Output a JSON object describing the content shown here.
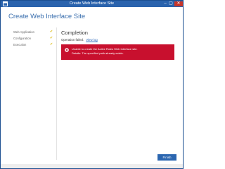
{
  "window": {
    "title": "Create Web Interface Site",
    "controls": {
      "minimize": "–",
      "maximize": "▢",
      "close": "✕"
    }
  },
  "page": {
    "heading": "Create Web Interface Site"
  },
  "nav": {
    "items": [
      {
        "label": "Web Application",
        "status": "done"
      },
      {
        "label": "Configuration",
        "status": "done"
      },
      {
        "label": "Execution",
        "status": "done"
      }
    ]
  },
  "main": {
    "section_title": "Completion",
    "status_text": "Operation failed.",
    "status_link": "View log",
    "error": {
      "line1": "Unable to create the Active Roles Web Interface site.",
      "line2": "Details: The specified path already exists."
    }
  },
  "footer": {
    "finish_label": "Finish"
  },
  "colors": {
    "titlebar": "#2a63ad",
    "heading": "#3a6fae",
    "error_bg": "#c8102e",
    "check": "#d9b600",
    "button": "#2b66b0"
  },
  "icons": {
    "app": "window-icon",
    "check": "check-icon",
    "error": "error-icon"
  }
}
